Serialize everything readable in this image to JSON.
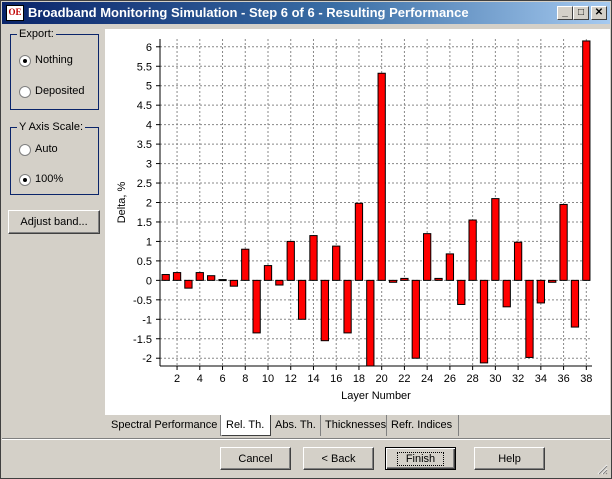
{
  "window": {
    "title": "Broadband Monitoring Simulation - Step 6 of 6 - Resulting Performance",
    "icon_text": "OE",
    "controls": {
      "minimize": "_",
      "maximize": "□",
      "close": "✕"
    }
  },
  "export_group": {
    "title": "Export:",
    "options": [
      {
        "label": "Nothing",
        "checked": true
      },
      {
        "label": "Deposited",
        "checked": false
      }
    ]
  },
  "y_axis_group": {
    "title": "Y Axis Scale:",
    "options": [
      {
        "label": "Auto",
        "checked": false
      },
      {
        "label": "100%",
        "checked": true
      }
    ]
  },
  "adjust_button": "Adjust band...",
  "tabs": [
    {
      "label": "Spectral Performance",
      "active": false
    },
    {
      "label": "Rel. Th.",
      "active": true
    },
    {
      "label": "Abs. Th.",
      "active": false
    },
    {
      "label": "Thicknesses",
      "active": false
    },
    {
      "label": "Refr. Indices",
      "active": false
    }
  ],
  "footer_buttons": {
    "cancel": "Cancel",
    "back": "< Back",
    "finish": "Finish",
    "help": "Help"
  },
  "chart_data": {
    "type": "bar",
    "xlabel": "Layer Number",
    "ylabel": "Delta, %",
    "ylim": [
      -2.2,
      6.2
    ],
    "y_ticks": [
      -2,
      -1.5,
      -1,
      -0.5,
      0,
      0.5,
      1,
      1.5,
      2,
      2.5,
      3,
      3.5,
      4,
      4.5,
      5,
      5.5,
      6
    ],
    "y_tick_labels": [
      "-2",
      "-1.5",
      "-1",
      "-0.5",
      "0",
      "0.5",
      "1",
      "1.5",
      "2",
      "2.5",
      "3",
      "3.5",
      "4",
      "4.5",
      "5",
      "5.5",
      "6"
    ],
    "x_tick_labels": [
      "2",
      "4",
      "6",
      "8",
      "10",
      "12",
      "14",
      "16",
      "18",
      "20",
      "22",
      "24",
      "26",
      "28",
      "30",
      "32",
      "34",
      "36",
      "38"
    ],
    "grid": true,
    "bar_color": "#ff0000",
    "categories": [
      1,
      2,
      3,
      4,
      5,
      6,
      7,
      8,
      9,
      10,
      11,
      12,
      13,
      14,
      15,
      16,
      17,
      18,
      19,
      20,
      21,
      22,
      23,
      24,
      25,
      26,
      27,
      28,
      29,
      30,
      31,
      32,
      33,
      34,
      35,
      36,
      37,
      38
    ],
    "values": [
      0.15,
      0.2,
      -0.2,
      0.2,
      0.12,
      0.02,
      -0.15,
      0.8,
      -1.35,
      0.38,
      -0.12,
      1.0,
      -1.0,
      1.15,
      -1.55,
      0.88,
      -1.35,
      1.98,
      -2.2,
      5.32,
      -0.05,
      0.05,
      -2.0,
      1.2,
      0.05,
      0.68,
      -0.62,
      1.55,
      -2.12,
      2.1,
      -0.68,
      0.98,
      -1.98,
      -0.58,
      -0.05,
      1.95,
      -1.2,
      6.15
    ]
  }
}
